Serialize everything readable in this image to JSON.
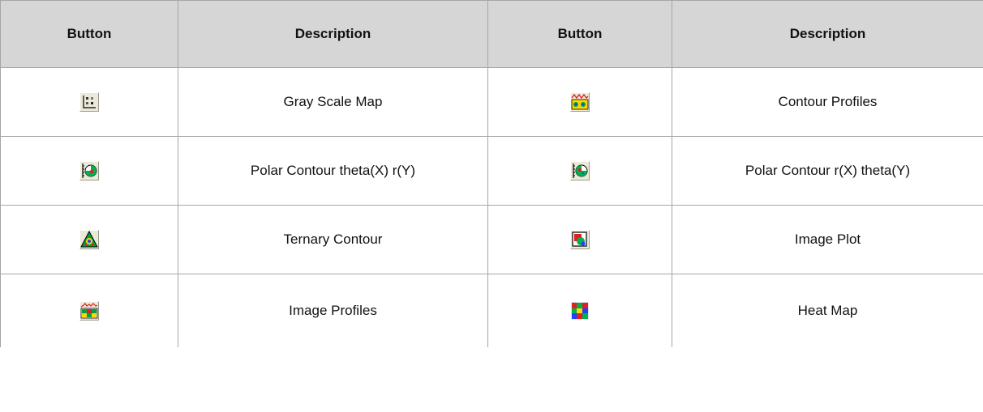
{
  "header": {
    "col1": "Button",
    "col2": "Description",
    "col3": "Button",
    "col4": "Description"
  },
  "rows": [
    {
      "left": {
        "icon": "gray-scale-map-icon",
        "description": "Gray Scale Map"
      },
      "right": {
        "icon": "contour-profiles-icon",
        "description": "Contour Profiles"
      }
    },
    {
      "left": {
        "icon": "polar-contour-theta-x-r-y-icon",
        "description": "Polar Contour theta(X) r(Y)"
      },
      "right": {
        "icon": "polar-contour-r-x-theta-y-icon",
        "description": "Polar Contour r(X) theta(Y)"
      }
    },
    {
      "left": {
        "icon": "ternary-contour-icon",
        "description": "Ternary Contour"
      },
      "right": {
        "icon": "image-plot-icon",
        "description": "Image Plot"
      }
    },
    {
      "left": {
        "icon": "image-profiles-icon",
        "description": "Image Profiles"
      },
      "right": {
        "icon": "heat-map-icon",
        "description": "Heat Map"
      }
    }
  ],
  "colors": {
    "header_bg": "#d6d6d6",
    "border": "#a6a6a6",
    "button_face": "#ece9d8"
  }
}
